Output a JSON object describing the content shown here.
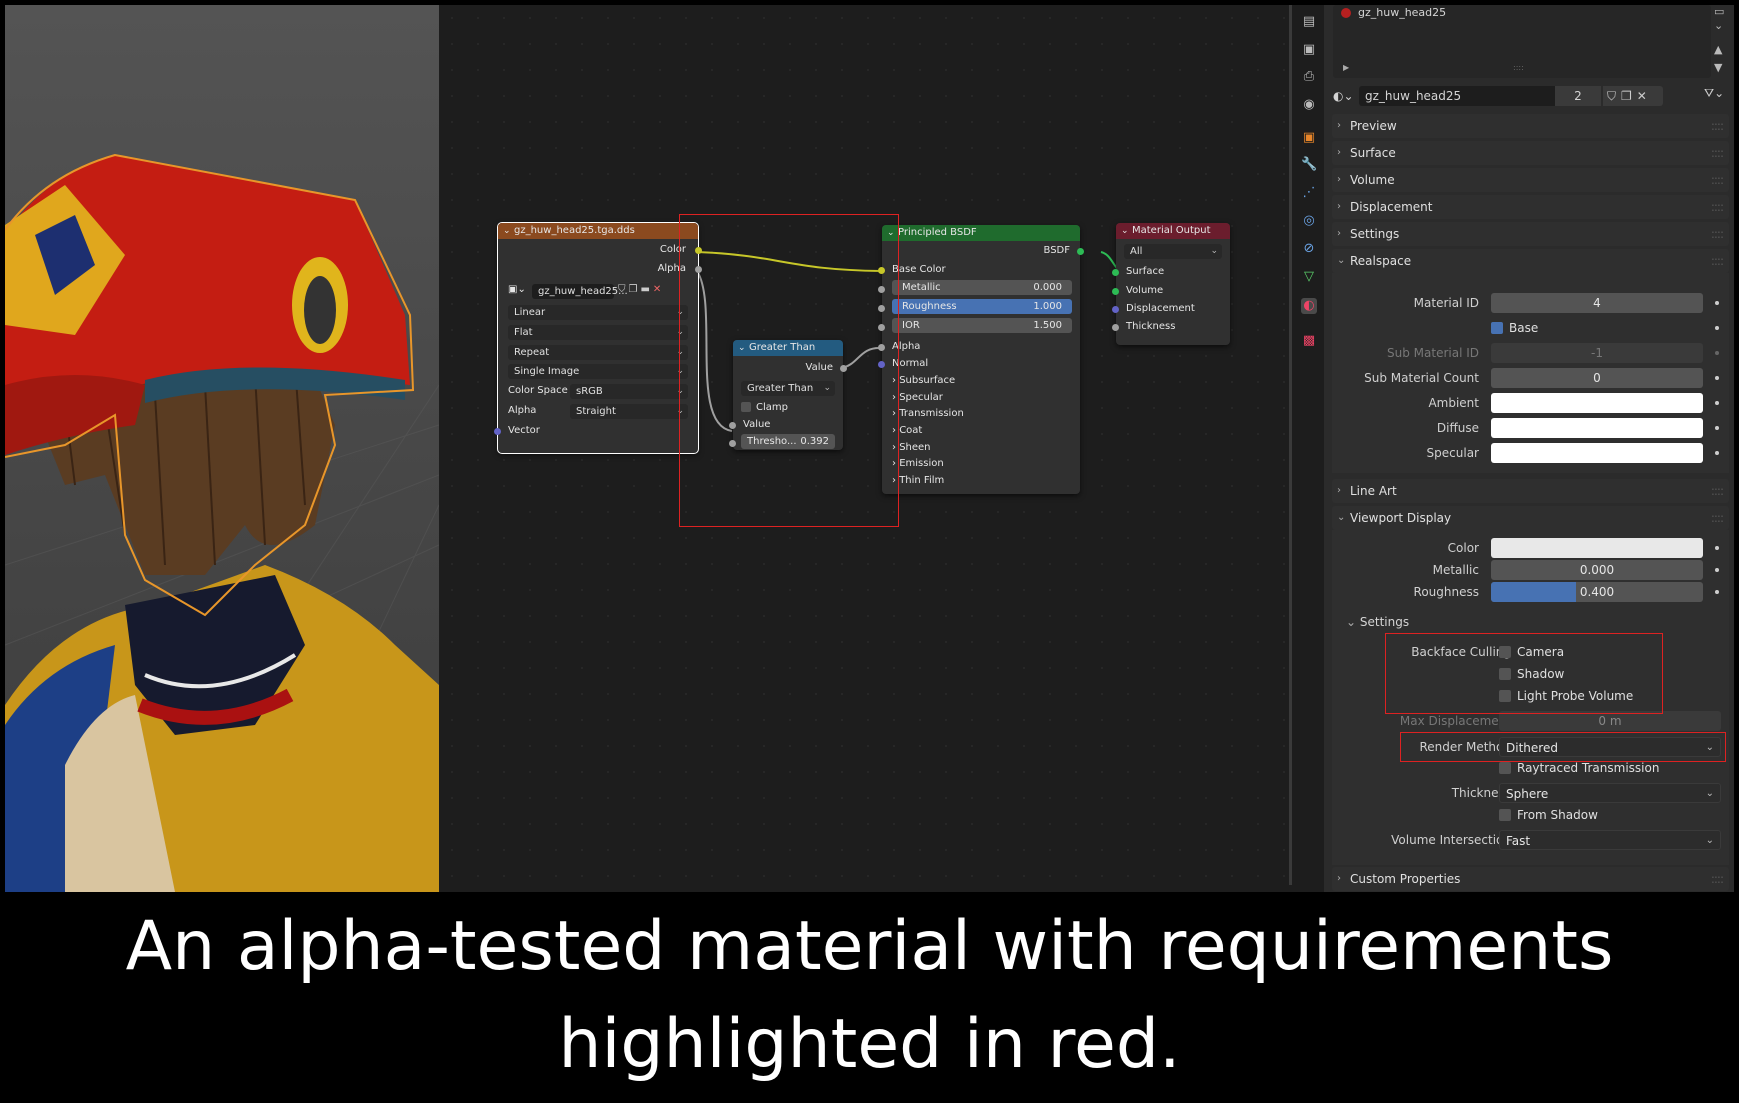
{
  "viewport": {
    "description_icon": "3d-viewport"
  },
  "nodes": {
    "image_texture": {
      "title": "gz_huw_head25.tga.dds",
      "outputs": [
        "Color",
        "Alpha"
      ],
      "image_name": "gz_huw_head25...",
      "interpolation": "Linear",
      "projection": "Flat",
      "extension": "Repeat",
      "source": "Single Image",
      "color_space_label": "Color Space",
      "color_space": "sRGB",
      "alpha_label": "Alpha",
      "alpha": "Straight",
      "input": "Vector",
      "header_color": "#8b4a1f"
    },
    "greater_than": {
      "title": "Greater Than",
      "output": "Value",
      "operation": "Greater Than",
      "clamp": "Clamp",
      "input": "Value",
      "threshold_label": "Thresho...",
      "threshold": "0.392",
      "header_color": "#235b80"
    },
    "principled": {
      "title": "Principled BSDF",
      "output": "BSDF",
      "base_color": "Base Color",
      "metallic_label": "Metallic",
      "metallic": "0.000",
      "roughness_label": "Roughness",
      "roughness": "1.000",
      "ior_label": "IOR",
      "ior": "1.500",
      "alpha": "Alpha",
      "normal": "Normal",
      "sections": [
        "Subsurface",
        "Specular",
        "Transmission",
        "Coat",
        "Sheen",
        "Emission",
        "Thin Film"
      ],
      "header_color": "#1f6b2d"
    },
    "output": {
      "title": "Material Output",
      "target": "All",
      "inputs": [
        "Surface",
        "Volume",
        "Displacement",
        "Thickness"
      ],
      "header_color": "#6b1d2d"
    }
  },
  "properties": {
    "slot_name": "gz_huw_head25",
    "material_name": "gz_huw_head25",
    "user_count": "2",
    "panels": {
      "preview": "Preview",
      "surface": "Surface",
      "volume": "Volume",
      "displacement": "Displacement",
      "settings": "Settings",
      "realspace": "Realspace",
      "line_art": "Line Art",
      "viewport_display": "Viewport Display",
      "vd_settings": "Settings",
      "custom_properties": "Custom Properties"
    },
    "realspace": {
      "material_id_label": "Material ID",
      "material_id": "4",
      "base_label": "Base",
      "sub_material_id_label": "Sub Material ID",
      "sub_material_id": "-1",
      "sub_material_count_label": "Sub Material Count",
      "sub_material_count": "0",
      "ambient_label": "Ambient",
      "diffuse_label": "Diffuse",
      "specular_label": "Specular"
    },
    "viewport_display": {
      "color_label": "Color",
      "metallic_label": "Metallic",
      "metallic": "0.000",
      "roughness_label": "Roughness",
      "roughness": "0.400",
      "roughness_fraction": 0.4
    },
    "vd_settings": {
      "backface_culling_label": "Backface Culling",
      "camera": "Camera",
      "shadow": "Shadow",
      "light_probe_volume": "Light Probe Volume",
      "max_displacement_label": "Max Displacement",
      "max_displacement": "0 m",
      "render_method_label": "Render Method",
      "render_method": "Dithered",
      "raytraced_transmission": "Raytraced Transmission",
      "thickness_label": "Thickness",
      "thickness": "Sphere",
      "from_shadow": "From Shadow",
      "volume_intersection_label": "Volume Intersection",
      "volume_intersection": "Fast"
    }
  },
  "caption": {
    "line1": "An alpha-tested material with requirements",
    "line2": "highlighted in red."
  },
  "colors": {
    "highlight": "#dd2222",
    "accent_blue": "#4772b3"
  }
}
